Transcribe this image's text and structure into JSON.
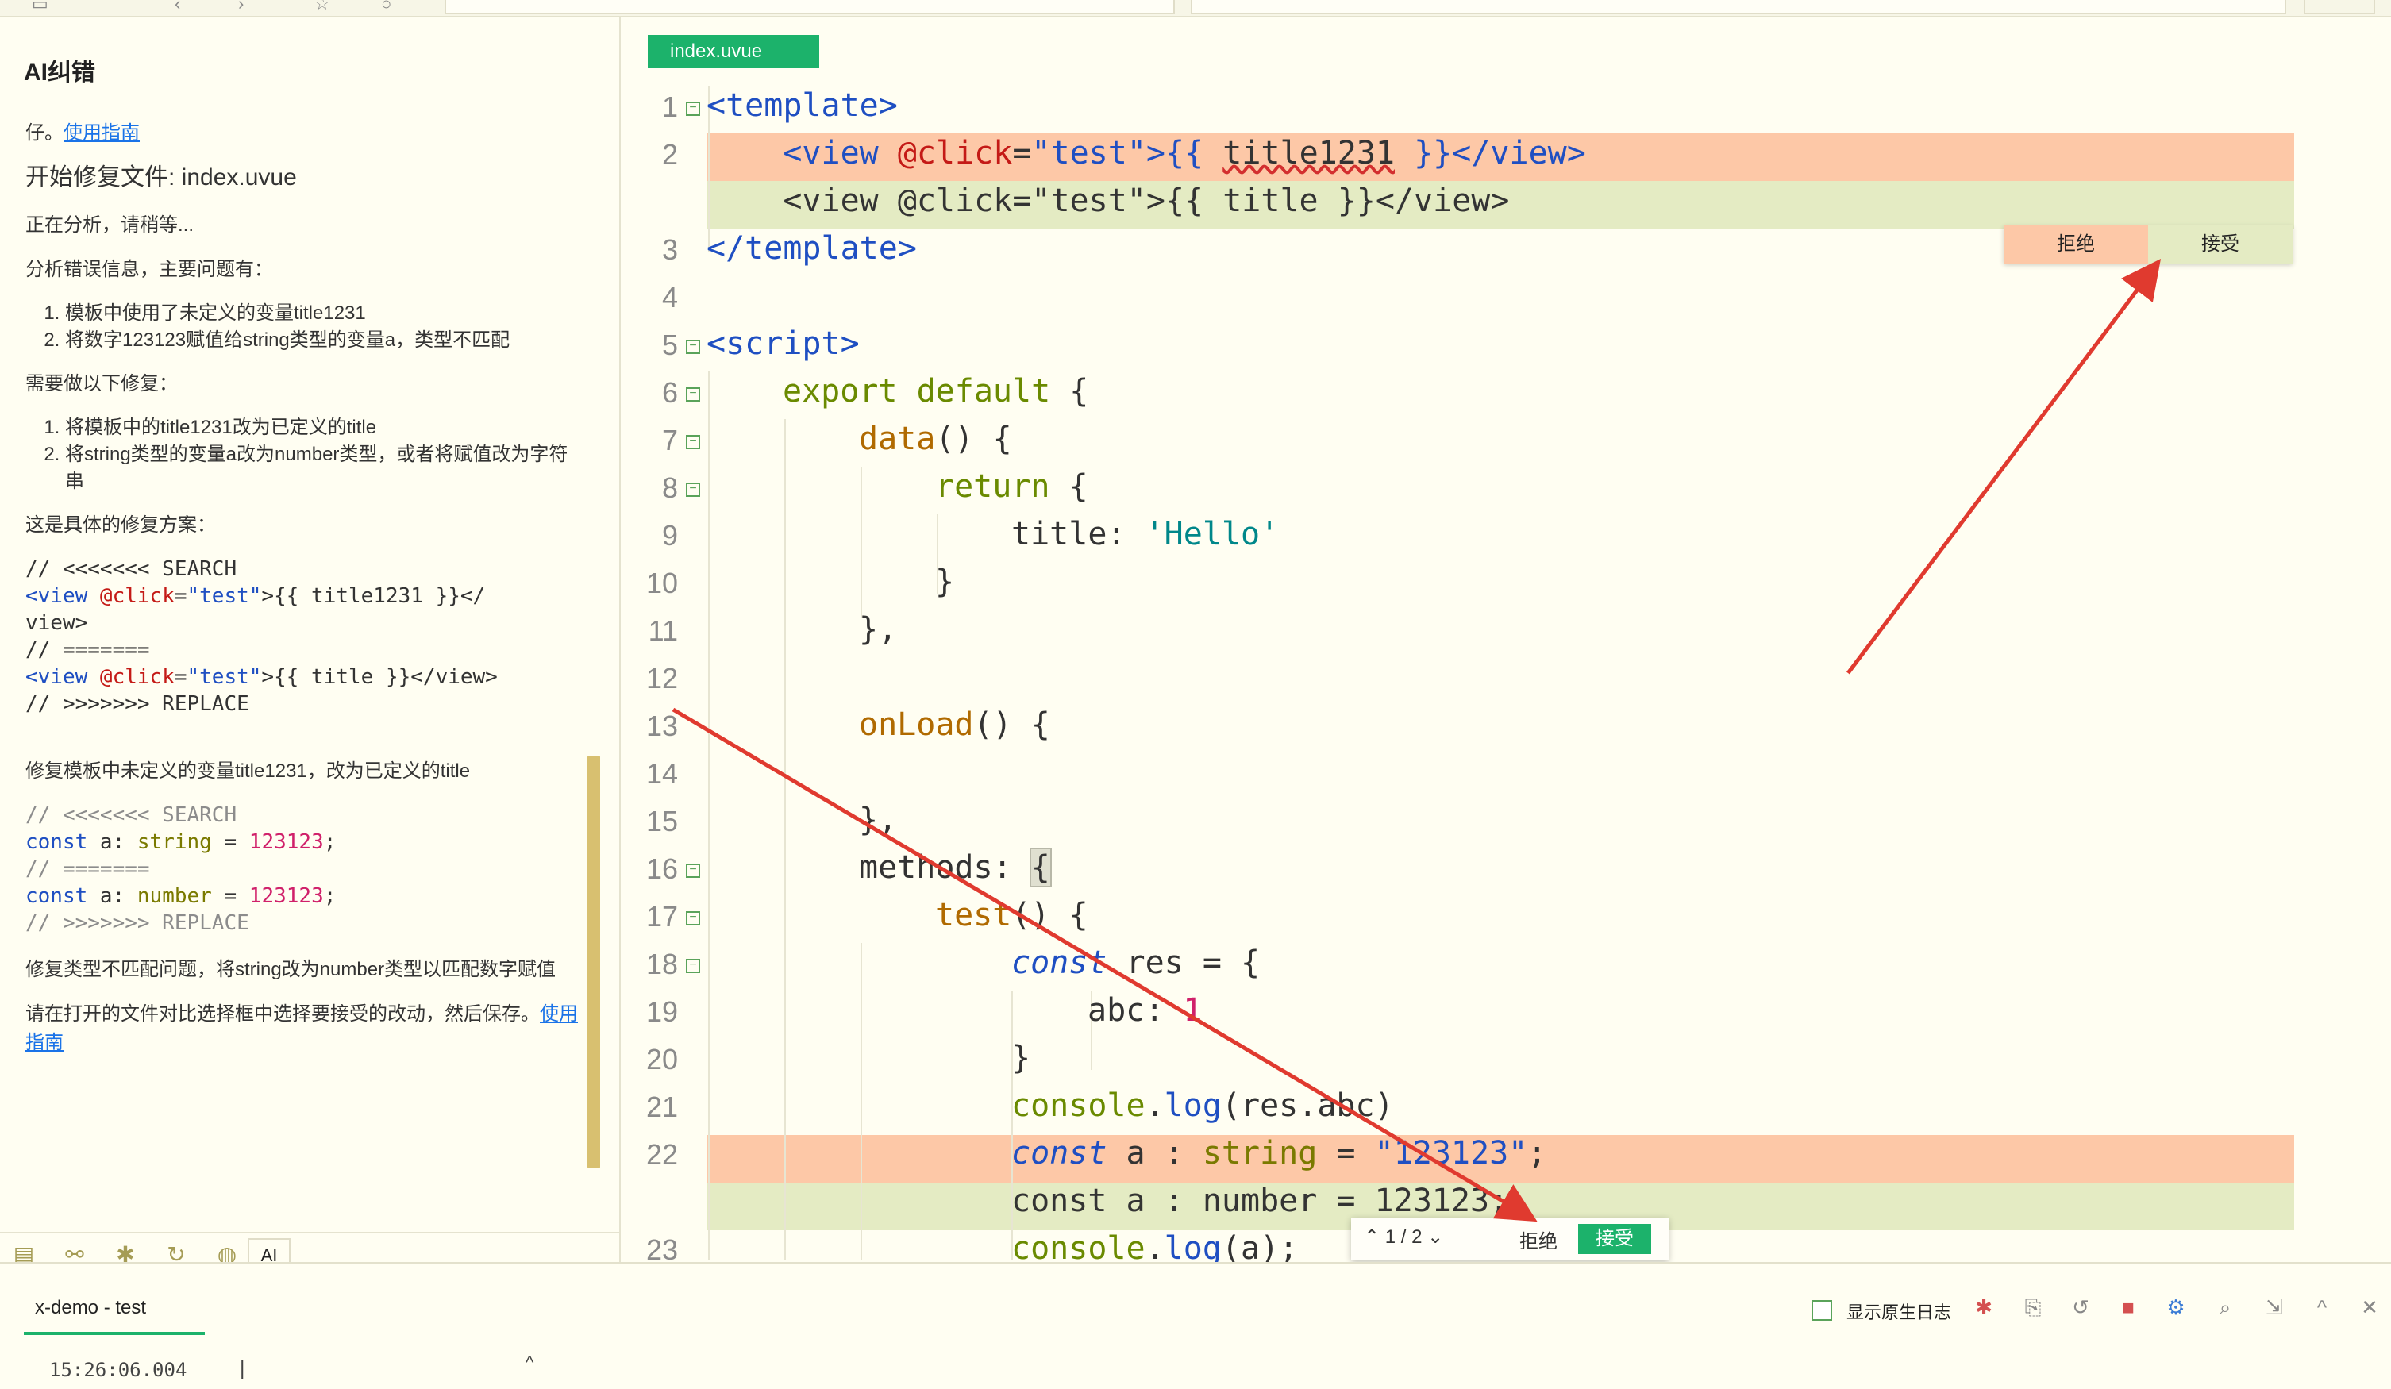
{
  "ai_panel": {
    "title": "AI纠错",
    "top_fragment": "仔。",
    "guide_link": "使用指南",
    "start_fix": "开始修复文件: index.uvue",
    "analyzing": "正在分析，请稍等...",
    "analysis_intro": "分析错误信息，主要问题有：",
    "problems": [
      "模板中使用了未定义的变量title1231",
      "将数字123123赋值给string类型的变量a，类型不匹配"
    ],
    "fix_intro": "需要做以下修复：",
    "fixes": [
      "将模板中的title1231改为已定义的title",
      "将string类型的变量a改为number类型，或者将赋值改为字符串"
    ],
    "plan_intro": "这是具体的修复方案：",
    "code1": {
      "search": "// <<<<<<< SEARCH",
      "old_tag_open": "<view ",
      "old_attr": "@click",
      "old_eq": "=",
      "old_str": "\"test\"",
      "old_rest": ">{{ title1231 }}</",
      "old_close": "view>",
      "sep": "// =======",
      "new_tag_open": "<view ",
      "new_attr": "@click",
      "new_eq": "=",
      "new_str": "\"test\"",
      "new_rest": ">{{ title }}</view>",
      "replace": "// >>>>>>> REPLACE"
    },
    "fix1_desc": "修复模板中未定义的变量title1231，改为已定义的title",
    "code2": {
      "search": "// <<<<<<< SEARCH",
      "old_kw": "const",
      "old_var": " a: ",
      "old_type": "string",
      "old_eq": " = ",
      "old_num": "123123",
      "old_end": ";",
      "sep": "// =======",
      "new_kw": "const",
      "new_var": " a: ",
      "new_type": "number",
      "new_eq": " = ",
      "new_num": "123123",
      "new_end": ";",
      "replace": "// >>>>>>> REPLACE"
    },
    "fix2_desc": "修复类型不匹配问题，将string改为number类型以匹配数字赋值",
    "final_note": "请在打开的文件对比选择框中选择要接受的改动，然后保存。",
    "final_link": "使用指南",
    "tab_ai": "AI"
  },
  "editor": {
    "file_tab": "index.uvue",
    "line_numbers": [
      "1",
      "2",
      "3",
      "4",
      "5",
      "6",
      "7",
      "8",
      "9",
      "10",
      "11",
      "12",
      "13",
      "14",
      "15",
      "16",
      "17",
      "18",
      "19",
      "20",
      "21",
      "22",
      "23"
    ],
    "lines": {
      "l1_tag": "<template>",
      "l2_indent": "    ",
      "l2_tag": "<view ",
      "l2_attr": "@click",
      "l2_eq": "=",
      "l2_str": "\"test\"",
      "l2_open": ">{{ ",
      "l2_var": "title1231",
      "l2_close": " }}",
      "l2_end": "</view>",
      "l2b": "    <view @click=\"test\">{{ title }}</view>",
      "l3_tag": "</template>",
      "l5_tag": "<script>",
      "l6_kw": "export default",
      "l6_rest": " {",
      "l7_fn": "data",
      "l7_rest": "() {",
      "l8_kw": "return",
      "l8_rest": " {",
      "l9_key": "title: ",
      "l9_str": "'Hello'",
      "l10": "}",
      "l11": "},",
      "l13_fn": "onLoad",
      "l13_rest": "() {",
      "l15": "},",
      "l16_key": "methods: ",
      "l16_br": "{",
      "l17_fn": "test",
      "l17_rest": "() {",
      "l18_kw": "const",
      "l18_rest": " res = {",
      "l19_key": "abc: ",
      "l19_num": "1",
      "l20": "}",
      "l21_obj": "console",
      "l21_dot": ".",
      "l21_fn": "log",
      "l21_rest": "(res.abc)",
      "l22_kw": "const",
      "l22_var": " a : ",
      "l22_type": "string",
      "l22_eq": " = ",
      "l22_str": "\"123123\"",
      "l22_end": ";",
      "l22b": "const a : number = 123123;",
      "l23_obj": "console",
      "l23_dot": ".",
      "l23_fn": "log",
      "l23_rest": "(a);"
    },
    "popup_top": {
      "reject": "拒绝",
      "accept": "接受"
    },
    "popup_bottom": {
      "nav": "⌃ 1 / 2 ⌄",
      "reject": "拒绝",
      "accept": "接受"
    }
  },
  "console": {
    "tab": "x-demo - test",
    "time": "15:26:06.004",
    "native_log_label": "显示原生日志"
  },
  "colors": {
    "accent_green": "#1cb26b",
    "diff_removed": "#fdc8a7",
    "diff_added": "#e4ebc3",
    "annotation_red": "#e03a2f"
  }
}
